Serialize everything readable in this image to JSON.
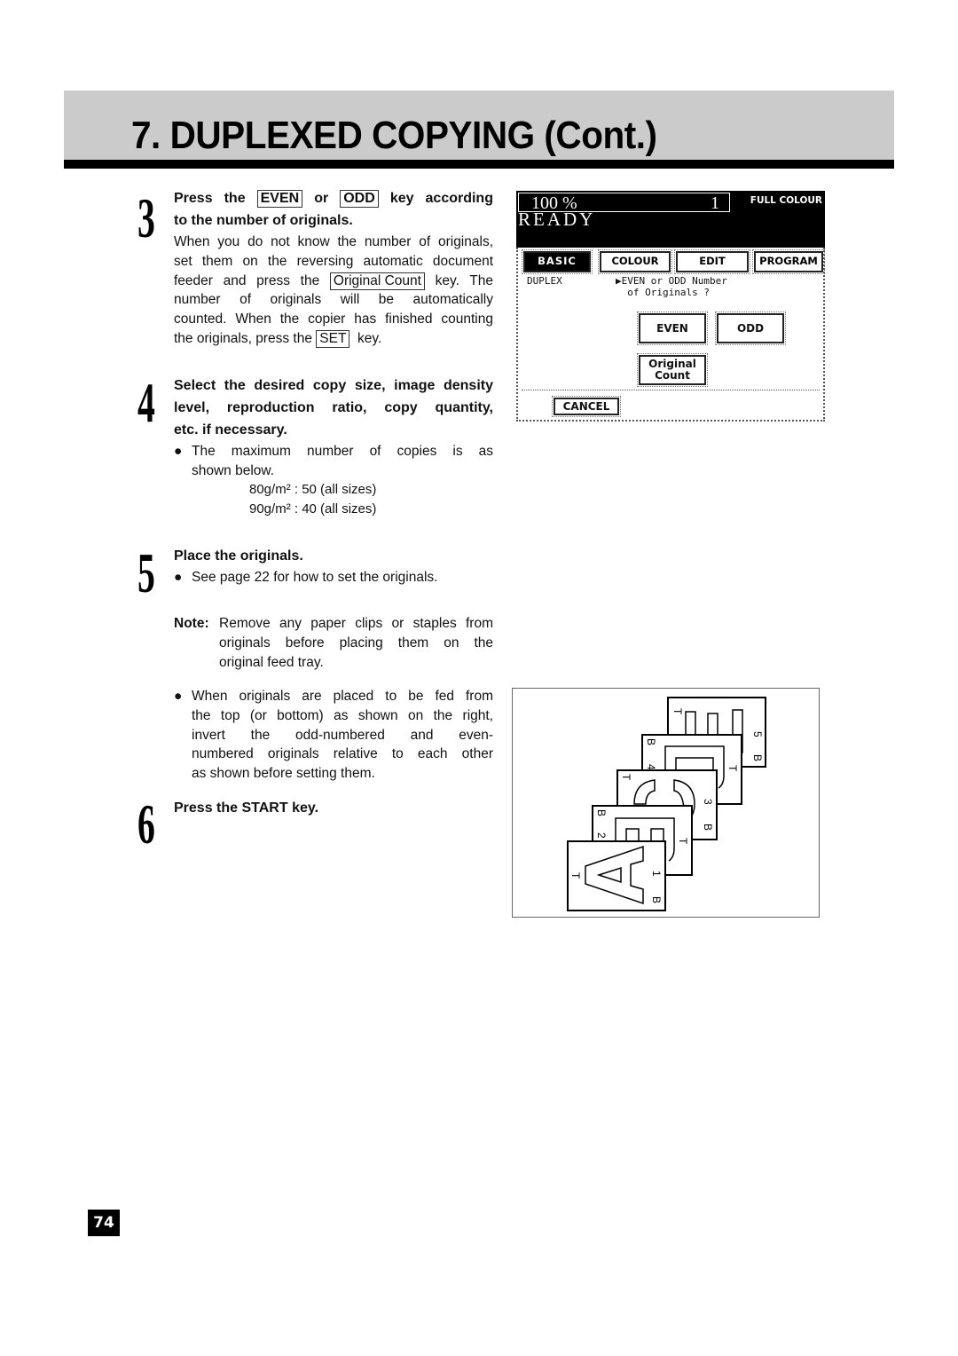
{
  "header": {
    "title": "7. DUPLEXED COPYING (Cont.)"
  },
  "steps": [
    {
      "number": "3",
      "heading_parts": {
        "pre": "Press the",
        "key1": "EVEN",
        "mid": "or",
        "key2": "ODD",
        "post": "key according",
        "line2": "to the number of originals."
      },
      "body_lines": {
        "l1": "When you do not know the number of originals,",
        "l2": "set them on the reversing automatic document",
        "l3_pre": "feeder and press the",
        "l3_key": "Original Count",
        "l3_post": "key.  The",
        "l4": "number of originals will be automatically",
        "l5": "counted. When the copier has finished counting",
        "l6_pre": "the originals, press the",
        "l6_key": "SET",
        "l6_post": "key."
      }
    },
    {
      "number": "4",
      "heading_lines": [
        "Select the desired copy size, image density",
        "level, reproduction ratio, copy quantity,",
        "etc. if necessary."
      ],
      "bullet": {
        "symbol": "●",
        "lines": [
          "The maximum number of copies is as",
          "shown below."
        ]
      },
      "max_copies": [
        {
          "weight": "80g/m²",
          "value": ": 50 (all sizes)"
        },
        {
          "weight": "90g/m²",
          "value": ": 40 (all sizes)"
        }
      ]
    },
    {
      "number": "5",
      "heading": "Place the originals.",
      "bullet": {
        "symbol": "●",
        "text": "See page 22 for how to set the originals."
      },
      "note": {
        "label": "Note:",
        "lines": [
          "Remove any paper clips or staples from",
          "originals before placing them on the",
          "original feed tray."
        ]
      },
      "bullet2": {
        "symbol": "●",
        "lines": [
          "When originals are placed to be fed from",
          "the top (or bottom) as shown on the right,",
          "invert the odd-numbered and even-",
          "numbered originals relative to each other",
          "as shown before setting them."
        ]
      }
    },
    {
      "number": "6",
      "heading": "Press the START key."
    }
  ],
  "lcd": {
    "ratio": "100 %",
    "quantity": "1",
    "colour_mode": "FULL COLOUR",
    "status": "READY",
    "tabs": [
      {
        "label": "BASIC",
        "active": true
      },
      {
        "label": "COLOUR",
        "active": false
      },
      {
        "label": "EDIT",
        "active": false
      },
      {
        "label": "PROGRAM",
        "active": false
      }
    ],
    "function_label": "DUPLEX",
    "prompt_line1": "▶EVEN or ODD Number",
    "prompt_line2": "  of Originals ?",
    "buttons": {
      "even": "EVEN",
      "odd": "ODD",
      "original_count_l1": "Original",
      "original_count_l2": "Count",
      "cancel": "CANCEL"
    }
  },
  "diagram": {
    "sheets": [
      {
        "page": "1",
        "letter": "A",
        "top_label": "T",
        "bottom_label": "B"
      },
      {
        "page": "2",
        "letter": "B",
        "top_label": "T",
        "bottom_label": "B"
      },
      {
        "page": "3",
        "letter": "C",
        "top_label": "T",
        "bottom_label": "B"
      },
      {
        "page": "4",
        "letter": "D",
        "top_label": "T",
        "bottom_label": "B"
      },
      {
        "page": "5",
        "letter": "E",
        "top_label": "T",
        "bottom_label": "B"
      }
    ]
  },
  "footer": {
    "page_number": "74"
  }
}
